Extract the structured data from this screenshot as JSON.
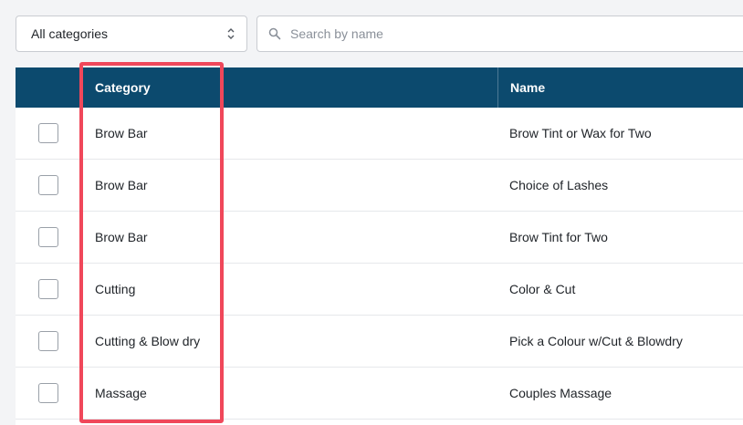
{
  "filters": {
    "category_select": {
      "selected": "All categories"
    },
    "search": {
      "placeholder": "Search by name",
      "value": ""
    }
  },
  "table": {
    "headers": {
      "category": "Category",
      "name": "Name"
    },
    "rows": [
      {
        "category": "Brow Bar",
        "name": "Brow Tint or Wax for Two"
      },
      {
        "category": "Brow Bar",
        "name": "Choice of Lashes"
      },
      {
        "category": "Brow Bar",
        "name": "Brow Tint for Two"
      },
      {
        "category": "Cutting",
        "name": "Color & Cut"
      },
      {
        "category": "Cutting & Blow dry",
        "name": "Pick a Colour w/Cut & Blowdry"
      },
      {
        "category": "Massage",
        "name": "Couples Massage"
      }
    ]
  },
  "icons": {
    "select": "chevron-up-down-icon",
    "search": "search-icon"
  },
  "colors": {
    "header_bg": "#0c4a6e",
    "highlight": "#f0475a",
    "page_bg": "#f3f4f6"
  }
}
